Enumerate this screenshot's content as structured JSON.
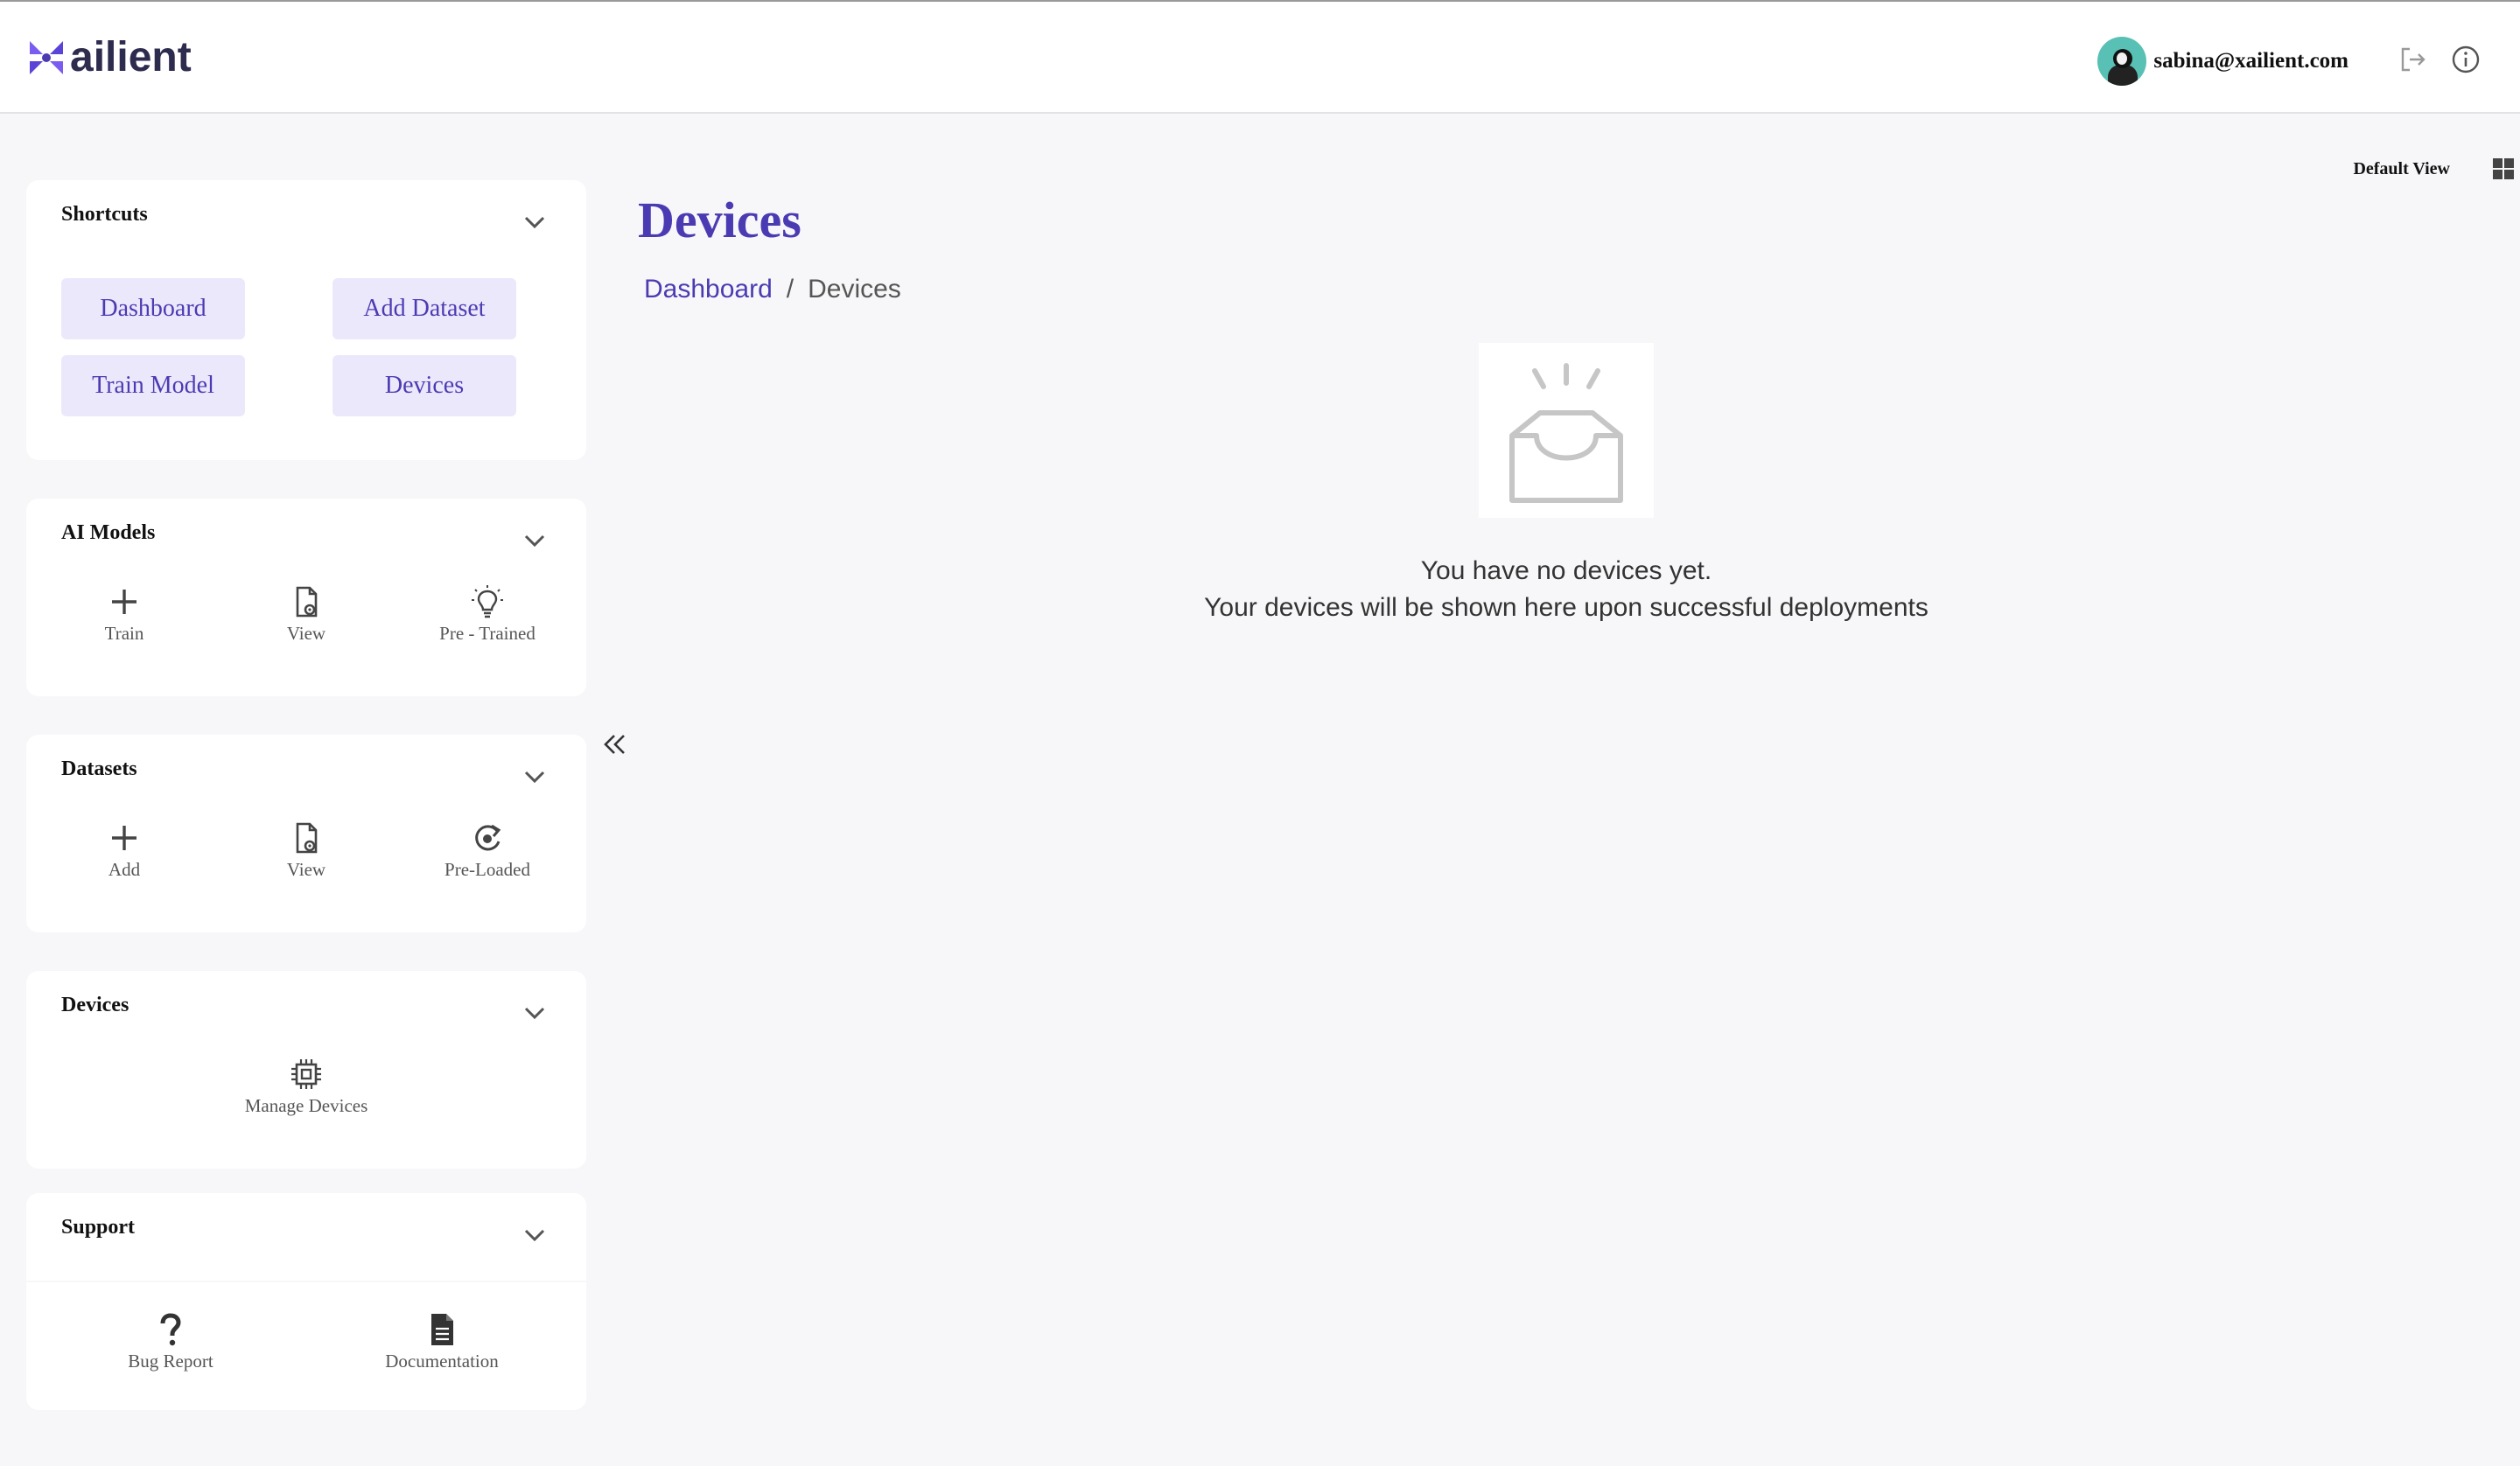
{
  "header": {
    "logo_text": "ailient",
    "user_email": "sabina@xailient.com",
    "icons": [
      "logout-icon",
      "info-icon"
    ]
  },
  "view": {
    "label": "Default View",
    "icon": "grid-icon"
  },
  "sidebar": {
    "shortcuts": {
      "title": "Shortcuts",
      "buttons": [
        "Dashboard",
        "Add Dataset",
        "Train Model",
        "Devices"
      ]
    },
    "ai_models": {
      "title": "AI Models",
      "items": [
        {
          "label": "Train",
          "icon": "plus-icon"
        },
        {
          "label": "View",
          "icon": "file-view-icon"
        },
        {
          "label": "Pre - Trained",
          "icon": "lightbulb-icon"
        }
      ]
    },
    "datasets": {
      "title": "Datasets",
      "items": [
        {
          "label": "Add",
          "icon": "plus-icon"
        },
        {
          "label": "View",
          "icon": "file-view-icon"
        },
        {
          "label": "Pre-Loaded",
          "icon": "reload-icon"
        }
      ]
    },
    "devices": {
      "title": "Devices",
      "items": [
        {
          "label": "Manage Devices",
          "icon": "chip-icon"
        }
      ]
    },
    "support": {
      "title": "Support",
      "items": [
        {
          "label": "Bug Report",
          "icon": "question-icon"
        },
        {
          "label": "Documentation",
          "icon": "document-icon"
        }
      ]
    }
  },
  "main": {
    "title": "Devices",
    "breadcrumb": {
      "link": "Dashboard",
      "separator": "/",
      "current": "Devices"
    },
    "empty_state": {
      "icon": "empty-inbox-icon",
      "line1": "You have no devices yet.",
      "line2": "Your devices will be shown here upon successful deployments"
    }
  },
  "colors": {
    "accent": "#4b3bb3",
    "button_bg": "#ece8fb",
    "page_bg": "#f7f7f9",
    "logo_dark": "#2d2b4e",
    "logo_purple": "#7b5cf0"
  }
}
